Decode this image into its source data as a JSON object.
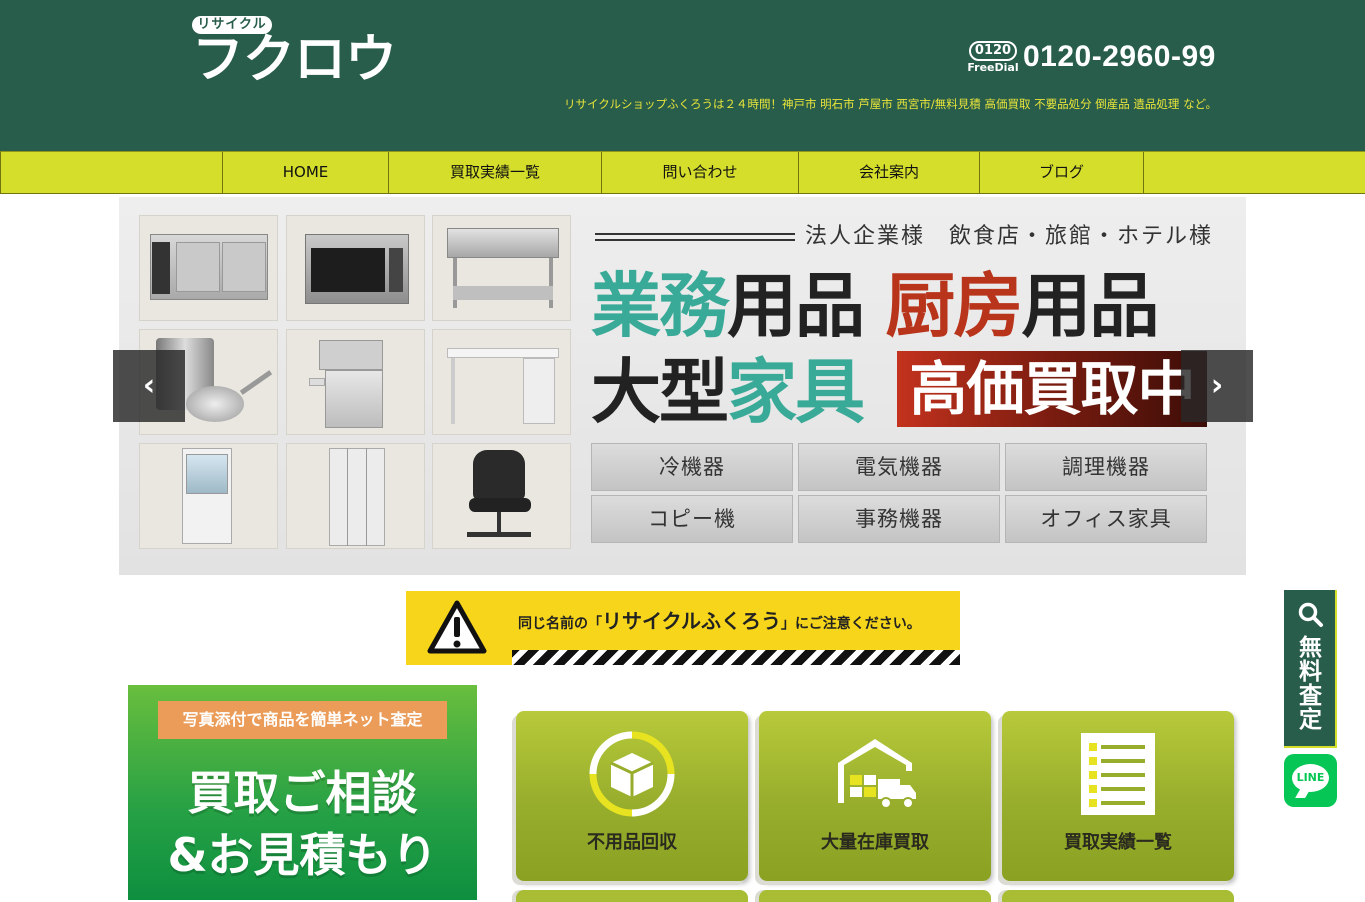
{
  "header": {
    "logo_badge": "リサイクル",
    "logo_main": "フクロウ",
    "freedial_top": "0120",
    "freedial_bottom": "FreeDial",
    "phone": "0120-2960-99",
    "tagline": "リサイクルショップふくろうは２４時間！神戸市 明石市 芦屋市 西宮市/無料見積 高価買取 不要品処分 倒産品 遺品処理 など。"
  },
  "nav": {
    "items": [
      {
        "label": "HOME"
      },
      {
        "label": "買取実績一覧"
      },
      {
        "label": "問い合わせ"
      },
      {
        "label": "会社案内"
      },
      {
        "label": "ブログ"
      }
    ]
  },
  "slider": {
    "headline_top": "法人企業様　飲食店・旅館・ホテル様",
    "line1_a": "業務",
    "line1_b": "用品",
    "line1_c": "厨房",
    "line1_d": "用品",
    "line2_a": "大型",
    "line2_b": "家具",
    "badge": "高価買取中",
    "categories": [
      "冷機器",
      "電気機器",
      "調理機器",
      "コピー機",
      "事務機器",
      "オフィス家具"
    ],
    "prev": "‹",
    "next": "›"
  },
  "warning": {
    "pre": "同じ名前の「",
    "name": "リサイクルふくろう",
    "post": "」にご注意ください。"
  },
  "consult": {
    "tag": "写真添付で商品を簡単ネット査定",
    "line1": "買取ご相談",
    "line2": "&お見積もり"
  },
  "tiles": [
    {
      "label": "不用品回収"
    },
    {
      "label": "大量在庫買取"
    },
    {
      "label": "買取実績一覧"
    }
  ],
  "side": {
    "search_text": "無料査定",
    "line_text": "LINE"
  },
  "colors": {
    "header_bg": "#285c4b",
    "nav_bg": "#d4de2b",
    "tagline": "#e8e53a",
    "accent_teal": "#3aaa98",
    "accent_red": "#b8341b"
  }
}
